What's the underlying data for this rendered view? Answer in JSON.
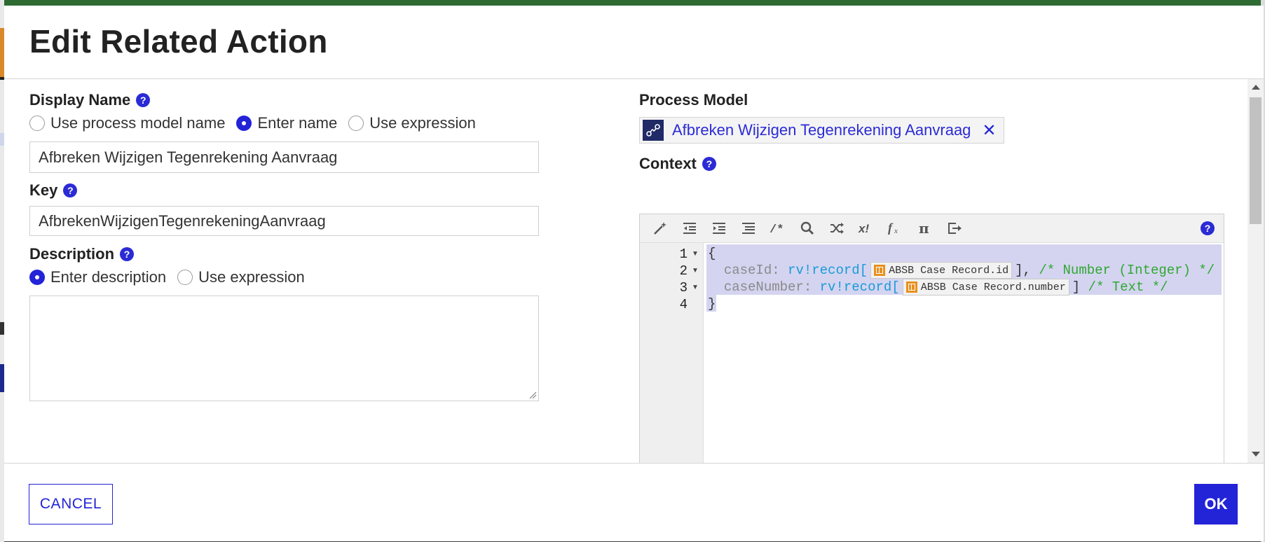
{
  "dialog": {
    "title": "Edit Related Action"
  },
  "display_name": {
    "label": "Display Name",
    "options": [
      "Use process model name",
      "Enter name",
      "Use expression"
    ],
    "selected": "Enter name",
    "value": "Afbreken Wijzigen Tegenrekening Aanvraag"
  },
  "key": {
    "label": "Key",
    "value": "AfbrekenWijzigenTegenrekeningAanvraag"
  },
  "description": {
    "label": "Description",
    "options": [
      "Enter description",
      "Use expression"
    ],
    "selected": "Enter description",
    "value": ""
  },
  "process_model": {
    "label": "Process Model",
    "value": "Afbreken Wijzigen Tegenrekening Aanvraag",
    "remove_glyph": "✕"
  },
  "context": {
    "label": "Context",
    "toolbar": [
      "magic-wand-icon",
      "outdent-icon",
      "indent-icon",
      "format-list-icon",
      "comment-icon",
      "search-icon",
      "shuffle-icon",
      "x-bang-icon",
      "function-icon",
      "pi-icon",
      "export-icon"
    ],
    "line_numbers": [
      "1",
      "2",
      "3",
      "4"
    ],
    "code": {
      "open_brace": "{",
      "close_brace": "}",
      "line2": {
        "key": "caseId",
        "colon": ":",
        "fn": "rv!record[",
        "record_ref": "ABSB Case Record.id",
        "close": "],",
        "comment": "/* Number (Integer) */"
      },
      "line3": {
        "key": "caseNumber",
        "colon": ":",
        "fn": "rv!record[",
        "record_ref": "ABSB Case Record.number",
        "close": "]",
        "comment": "/* Text */"
      }
    }
  },
  "footer": {
    "cancel_label": "CANCEL",
    "ok_label": "OK"
  },
  "colors": {
    "accent": "#2323d8",
    "selection": "#d4d4f1",
    "record_icon": "#e8901e",
    "function": "#1a9ad6",
    "comment": "#2fa82f"
  }
}
